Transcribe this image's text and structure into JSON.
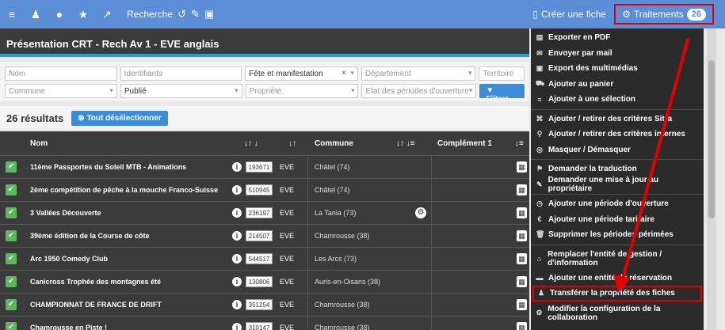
{
  "topbar": {
    "search_label": "Recherche",
    "create_label": "Créer une fiche",
    "traitements_label": "Traitements",
    "traitements_count": "26"
  },
  "title": "Présentation CRT - Rech Av 1 - EVE anglais",
  "filters": {
    "nom": "Nom",
    "identifiants": "Identifiants",
    "fete": "Fête et manifestation",
    "departement": "Département",
    "territoire": "Territoire",
    "commune": "Commune",
    "publie": "Publié",
    "propriete": "Propriété",
    "etat": "Etat des périodes d'ouverture",
    "filtrer": "Filtrer"
  },
  "results": {
    "count": "26 résultats",
    "deselect": "Tout désélectionner"
  },
  "table": {
    "col_nom": "Nom",
    "col_commune": "Commune",
    "col_complement": "Complément 1",
    "rows": [
      {
        "name": "11ème Passportes du Soleil MTB - Animations",
        "id": "193671",
        "code": "EVE",
        "commune": "Châtel (74)"
      },
      {
        "name": "2ème compétition de pêche à la mouche Franco-Suisse",
        "id": "510945",
        "code": "EVE",
        "commune": "Châtel (74)"
      },
      {
        "name": "3 Vallées Découverte",
        "id": "236197",
        "code": "EVE",
        "commune": "La Tania (73)"
      },
      {
        "name": "39ème édition de la Course de côte",
        "id": "214507",
        "code": "EVE",
        "commune": "Chamrousse (38)"
      },
      {
        "name": "Arc 1950 Comedy Club",
        "id": "544517",
        "code": "EVE",
        "commune": "Les Arcs (73)"
      },
      {
        "name": "Canicross Trophée des montagnes été",
        "id": "130806",
        "code": "EVE",
        "commune": "Auris-en-Oisans (38)"
      },
      {
        "name": "CHAMPIONNAT DE FRANCE DE DRIFT",
        "id": "351254",
        "code": "EVE",
        "commune": "Chamrousse (38)"
      },
      {
        "name": "Chamrousse en Piste !",
        "id": "310147",
        "code": "EVE",
        "commune": "Chamrousse (38)"
      }
    ]
  },
  "menu": {
    "items": [
      {
        "label": "Exporter en PDF",
        "icon": "pdf-icon",
        "glyph": "▤"
      },
      {
        "label": "Envoyer par mail",
        "icon": "mail-icon",
        "glyph": "✉"
      },
      {
        "label": "Export des multimédias",
        "icon": "image-icon",
        "glyph": "▣"
      },
      {
        "label": "Ajouter au panier",
        "icon": "cart-icon",
        "glyph": "⛟"
      },
      {
        "label": "Ajouter à une sélection",
        "icon": "list-icon",
        "glyph": "≡"
      },
      {
        "label": "Ajouter / retirer des critères Sitra",
        "icon": "sitemap-icon",
        "glyph": "⌘"
      },
      {
        "label": "Ajouter / retirer des critères internes",
        "icon": "pin-icon",
        "glyph": "⚲"
      },
      {
        "label": "Masquer / Démasquer",
        "icon": "eye-slash-icon",
        "glyph": "◎"
      },
      {
        "label": "Demander la traduction",
        "icon": "flag-icon",
        "glyph": "⚑"
      },
      {
        "label": "Demander une mise à jour au propriétaire",
        "icon": "edit-icon",
        "glyph": "✎"
      },
      {
        "label": "Ajouter une période d'ouverture",
        "icon": "clock-icon",
        "glyph": "◷"
      },
      {
        "label": "Ajouter une période tarifaire",
        "icon": "euro-icon",
        "glyph": "€"
      },
      {
        "label": "Supprimer les périodes périmées",
        "icon": "trash-icon",
        "glyph": "🗑"
      },
      {
        "label": "Remplacer l'entité de gestion / d'information",
        "icon": "building-icon",
        "glyph": "⌂"
      },
      {
        "label": "Ajouter une entité de réservation",
        "icon": "suitcase-icon",
        "glyph": "▬"
      },
      {
        "label": "Transférer la propriété des fiches",
        "icon": "user-icon",
        "glyph": "♟"
      },
      {
        "label": "Modifier la configuration de la collaboration",
        "icon": "cogs-icon",
        "glyph": "⚙"
      }
    ]
  },
  "colors": {
    "topbar": "#5b8ed6",
    "dark": "#3b3b3b",
    "accent": "#1e9fd6",
    "highlight": "#e00000",
    "check": "#5cb85c"
  }
}
